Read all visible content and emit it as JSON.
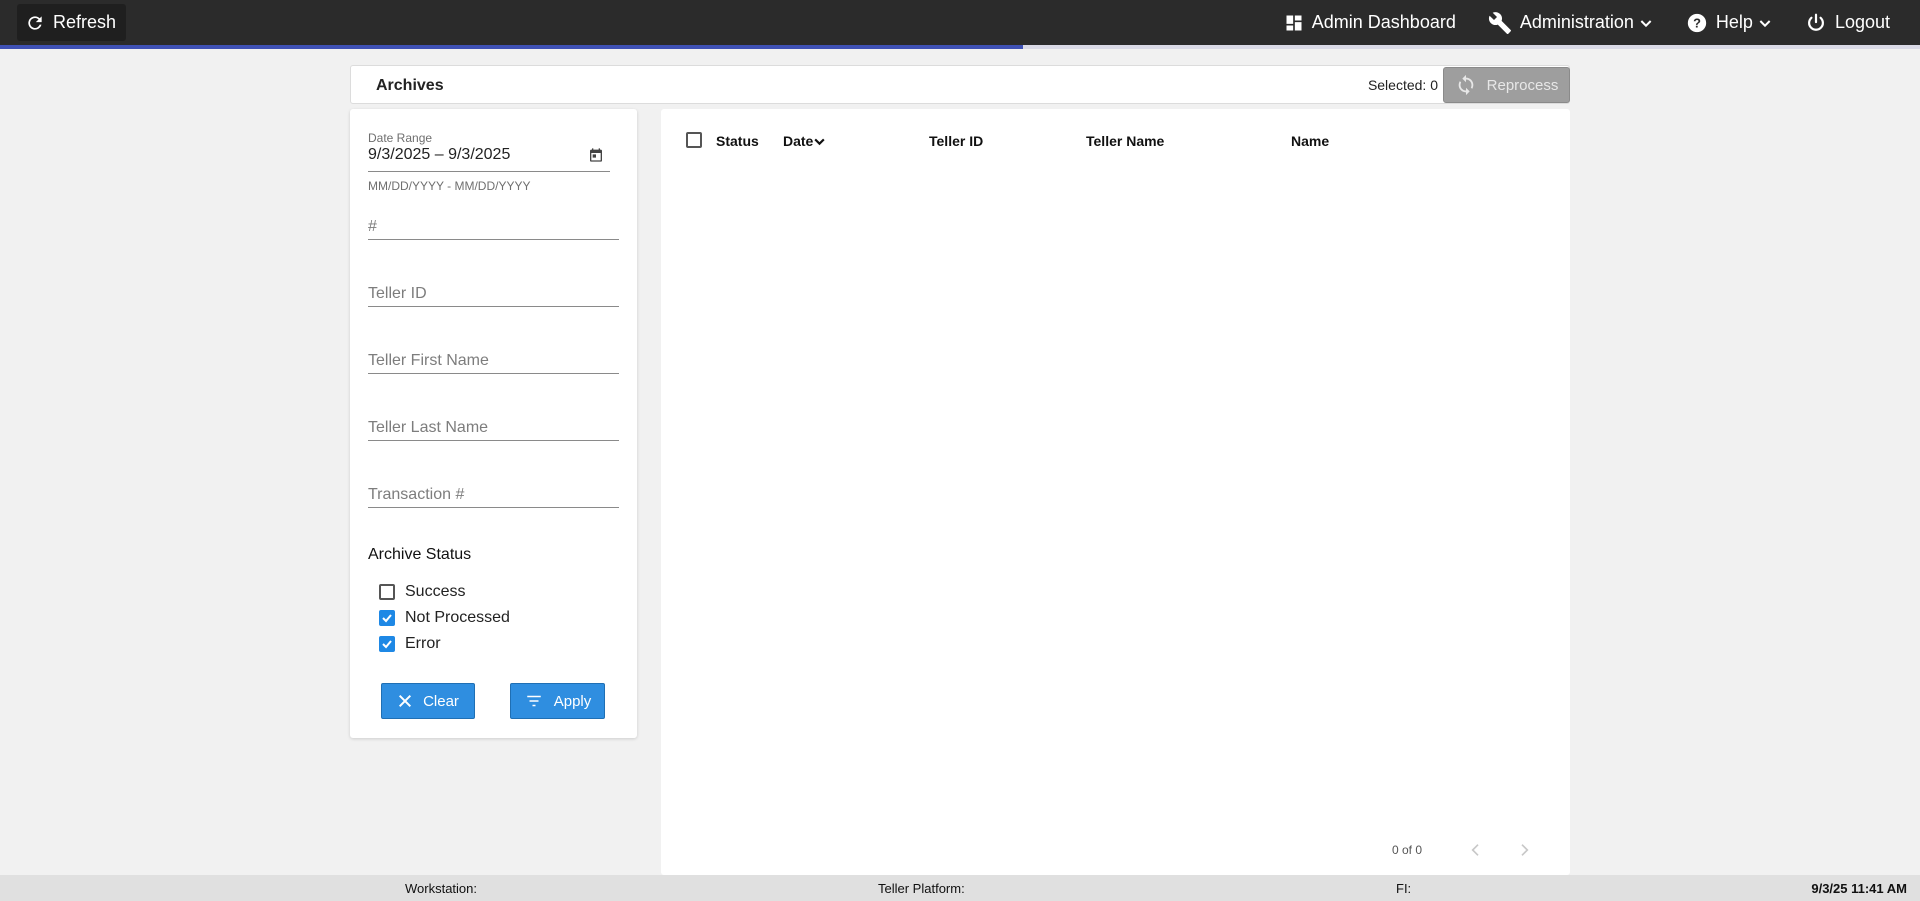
{
  "topbar": {
    "refresh_label": "Refresh",
    "nav": {
      "admin_dashboard": "Admin Dashboard",
      "administration": "Administration",
      "help": "Help",
      "logout": "Logout"
    },
    "load_progress": 0.533
  },
  "header": {
    "title": "Archives",
    "selected_label": "Selected: 0",
    "reprocess_label": "Reprocess"
  },
  "filters": {
    "date_range": {
      "label": "Date Range",
      "value": "9/3/2025 – 9/3/2025",
      "hint": "MM/DD/YYYY - MM/DD/YYYY"
    },
    "number_placeholder": "#",
    "teller_id_placeholder": "Teller ID",
    "teller_first_name_placeholder": "Teller First Name",
    "teller_last_name_placeholder": "Teller Last Name",
    "transaction_placeholder": "Transaction #",
    "archive_status": {
      "label": "Archive Status",
      "options": [
        {
          "label": "Success",
          "checked": false
        },
        {
          "label": "Not Processed",
          "checked": true
        },
        {
          "label": "Error",
          "checked": true
        }
      ]
    },
    "clear_label": "Clear",
    "apply_label": "Apply"
  },
  "table": {
    "columns": [
      "Status",
      "Date",
      "Teller ID",
      "Teller Name",
      "Name"
    ],
    "sort_column": "Date",
    "rows": [],
    "pagination": "0 of 0"
  },
  "footer": {
    "workstation": "Workstation:",
    "teller_platform": "Teller Platform:",
    "fi": "FI:",
    "datetime": "9/3/25 11:41 AM"
  },
  "colors": {
    "topbar": "#2b2b2b",
    "accent": "#3f51b5",
    "button_blue": "#2f8ee0",
    "disabled_button": "#9e9e9e"
  }
}
